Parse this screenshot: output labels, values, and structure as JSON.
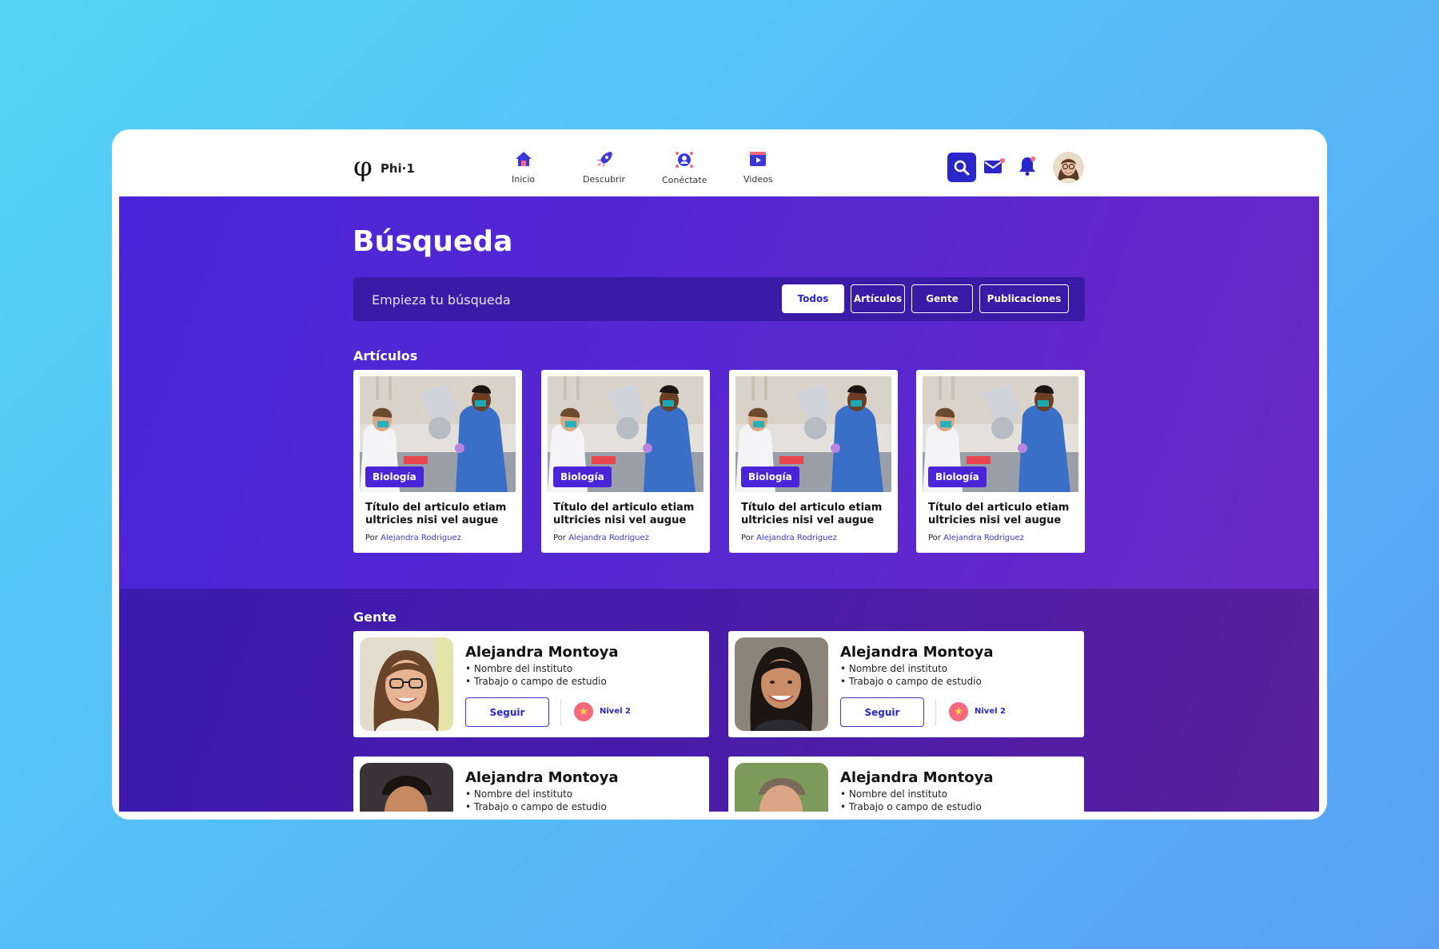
{
  "nav": {
    "brand": "Phi·1",
    "items": [
      {
        "label": "Inicio"
      },
      {
        "label": "Descubrir"
      },
      {
        "label": "Conéctate"
      },
      {
        "label": "Videos"
      }
    ]
  },
  "search": {
    "title": "Búsqueda",
    "placeholder": "Empieza tu búsqueda",
    "filters": [
      "Todos",
      "Artículos",
      "Gente",
      "Publicaciones"
    ]
  },
  "articles": {
    "section_title": "Artículos",
    "items": [
      {
        "tag": "Biología",
        "title": "Título del articulo etiam ultricies nisi vel augue",
        "by": "Por",
        "author": "Alejandra Rodriguez"
      },
      {
        "tag": "Biología",
        "title": "Título del articulo etiam ultricies nisi vel augue",
        "by": "Por",
        "author": "Alejandra Rodriguez"
      },
      {
        "tag": "Biología",
        "title": "Título del articulo etiam ultricies nisi vel augue",
        "by": "Por",
        "author": "Alejandra Rodriguez"
      },
      {
        "tag": "Biología",
        "title": "Título del articulo etiam ultricies nisi vel augue",
        "by": "Por",
        "author": "Alejandra Rodriguez"
      }
    ]
  },
  "people": {
    "section_title": "Gente",
    "items": [
      {
        "name": "Alejandra Montoya",
        "line1": "• Nombre del instituto",
        "line2": "• Trabajo o campo de estudio",
        "follow": "Seguir",
        "level": "Nivel 2"
      },
      {
        "name": "Alejandra Montoya",
        "line1": "• Nombre del instituto",
        "line2": "• Trabajo o campo de estudio",
        "follow": "Seguir",
        "level": "Nivel 2"
      },
      {
        "name": "Alejandra Montoya",
        "line1": "• Nombre del instituto",
        "line2": "• Trabajo o campo de estudio"
      },
      {
        "name": "Alejandra Montoya",
        "line1": "• Nombre del instituto",
        "line2": "• Trabajo o campo de estudio"
      }
    ]
  },
  "colors": {
    "accent": "#2a26c9",
    "hero": "#4a24d8",
    "tag": "#4a24d8",
    "link": "#3b37d9",
    "badge": "#f46a7c"
  }
}
